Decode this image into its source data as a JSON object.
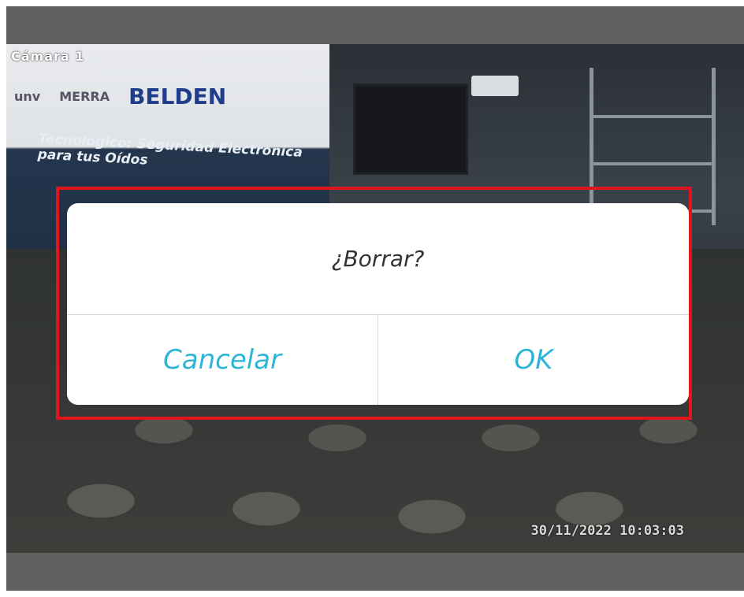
{
  "camera": {
    "label": "Cámara 1",
    "timestamp": "30/11/2022 10:03:03",
    "banner": {
      "logos": [
        "unv",
        "MERRA",
        "BELDEN"
      ],
      "headline": "Tecnológico: Seguridad Electrónica para tus Oídos"
    }
  },
  "dialog": {
    "title": "¿Borrar?",
    "cancel_label": "Cancelar",
    "ok_label": "OK"
  },
  "colors": {
    "highlight_border": "#e0151d",
    "button_text": "#2db5d6",
    "dialog_bg": "#ffffff"
  }
}
